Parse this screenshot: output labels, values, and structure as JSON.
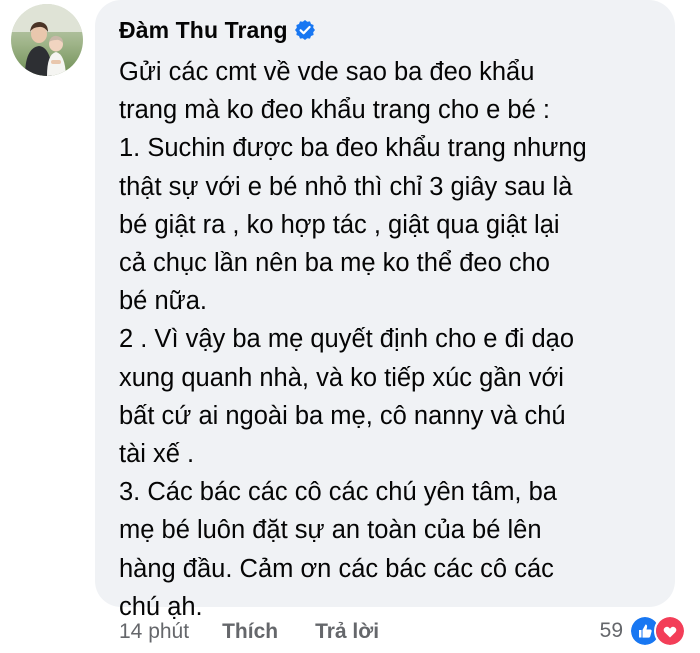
{
  "author": {
    "name": "Đàm Thu Trang",
    "verified_icon": "verified-badge-icon"
  },
  "comment": {
    "lines": [
      "Gửi các cmt về vde sao ba đeo khẩu",
      "trang mà ko đeo khẩu trang cho e bé :",
      "1. Suchin được ba đeo khẩu trang nhưng",
      "thật sự với e bé nhỏ thì chỉ 3 giây sau là",
      "bé giật ra , ko hợp tác , giật qua giật lại",
      "cả chục lần nên ba mẹ ko thể đeo cho",
      "bé nữa.",
      "2 . Vì vậy ba mẹ quyết định cho e đi dạo",
      "xung quanh nhà, và ko tiếp xúc gần với",
      "bất cứ ai ngoài ba mẹ, cô nanny và chú",
      "tài xế .",
      "3. Các bác các cô các chú yên tâm, ba",
      "mẹ bé luôn đặt sự an toàn của bé lên",
      "hàng đầu. Cảm ơn các bác các cô các",
      "chú ạh."
    ]
  },
  "actions": {
    "time": "14 phút",
    "like": "Thích",
    "reply": "Trả lời"
  },
  "reactions": {
    "count": "59",
    "icons": [
      "like-reaction-icon",
      "love-reaction-icon"
    ]
  },
  "colors": {
    "bubble": "#f0f2f5",
    "text": "#050505",
    "secondary": "#65676b",
    "like_blue": "#1877f2",
    "love_red": "#f33e58"
  }
}
